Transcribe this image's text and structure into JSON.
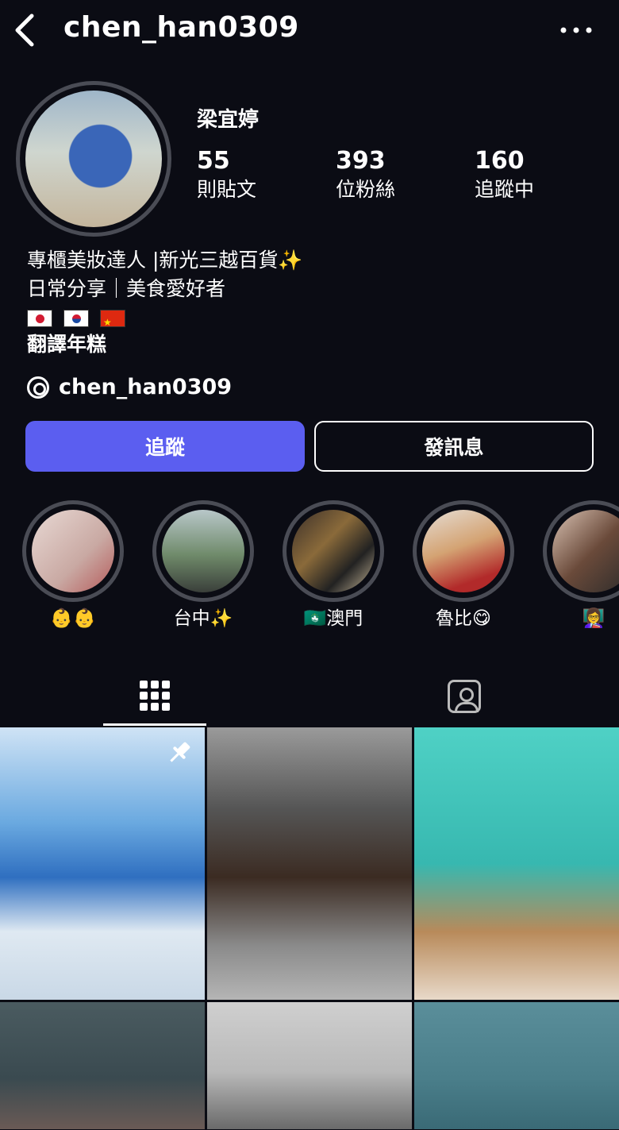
{
  "header": {
    "username": "chen_han0309",
    "back_icon": "chevron-left-icon",
    "more_icon": "more-horizontal-icon"
  },
  "profile": {
    "display_name": "梁宜婷",
    "stats": [
      {
        "value": "55",
        "label": "則貼文"
      },
      {
        "value": "393",
        "label": "位粉絲"
      },
      {
        "value": "160",
        "label": "追蹤中"
      }
    ],
    "bio": {
      "line1": "專櫃美妝達人 |新光三越百貨✨",
      "line2": "日常分享｜美食愛好者",
      "flags": [
        "japan-flag",
        "korea-flag",
        "china-flag"
      ],
      "line4": "翻譯年糕"
    },
    "threads_handle": "chen_han0309"
  },
  "actions": {
    "follow_label": "追蹤",
    "message_label": "發訊息"
  },
  "highlights": [
    {
      "label": "👶👶"
    },
    {
      "label": "台中✨"
    },
    {
      "label": "🇲🇴澳門"
    },
    {
      "label": "魯比😋"
    },
    {
      "label": "👩‍🏫"
    }
  ],
  "tabs": [
    {
      "name": "posts-grid",
      "icon": "grid-icon",
      "active": true
    },
    {
      "name": "tagged",
      "icon": "tagged-person-icon",
      "active": false
    }
  ],
  "colors": {
    "background": "#0b0c14",
    "follow_button": "#5b5ef0",
    "ring": "#4a4c55"
  }
}
